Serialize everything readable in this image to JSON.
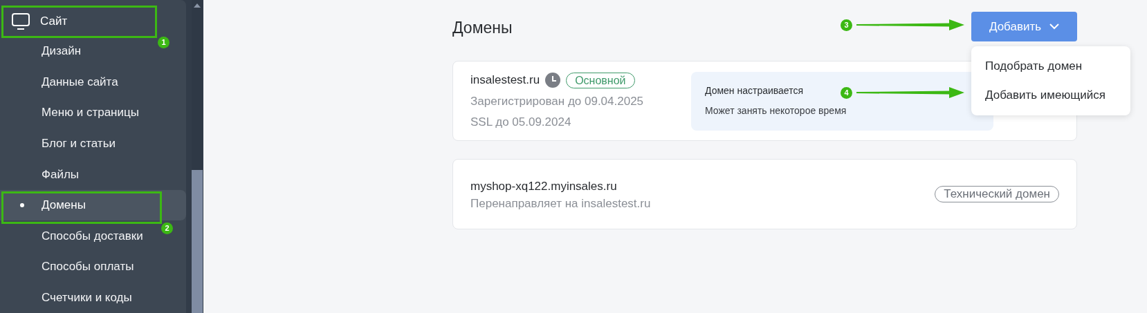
{
  "sidebar": {
    "section": {
      "label": "Сайт"
    },
    "items": [
      {
        "label": "Дизайн",
        "selected": false
      },
      {
        "label": "Данные сайта",
        "selected": false
      },
      {
        "label": "Меню и страницы",
        "selected": false
      },
      {
        "label": "Блог и статьи",
        "selected": false
      },
      {
        "label": "Файлы",
        "selected": false
      },
      {
        "label": "Домены",
        "selected": true
      },
      {
        "label": "Способы доставки",
        "selected": false
      },
      {
        "label": "Способы оплаты",
        "selected": false
      },
      {
        "label": "Счетчики и коды",
        "selected": false
      }
    ]
  },
  "main": {
    "title": "Домены",
    "add_button": {
      "label": "Добавить",
      "expanded": true
    },
    "menu": [
      {
        "label": "Подобрать домен"
      },
      {
        "label": "Добавить имеющийся"
      }
    ],
    "domains": [
      {
        "name": "insalestest.ru",
        "pending": true,
        "badge": {
          "label": "Основной",
          "kind": "primary"
        },
        "details": [
          "Зарегистрирован до 09.04.2025",
          "SSL до 05.09.2024"
        ],
        "notice": {
          "title": "Домен настраивается",
          "text": "Может занять некоторое время"
        }
      },
      {
        "name": "myshop-xq122.myinsales.ru",
        "pending": false,
        "badge": {
          "label": "Технический домен",
          "kind": "technical"
        },
        "details": [
          "Перенаправляет на insalestest.ru"
        ]
      }
    ]
  },
  "annotations": [
    {
      "number": "1"
    },
    {
      "number": "2"
    },
    {
      "number": "3"
    },
    {
      "number": "4"
    }
  ]
}
